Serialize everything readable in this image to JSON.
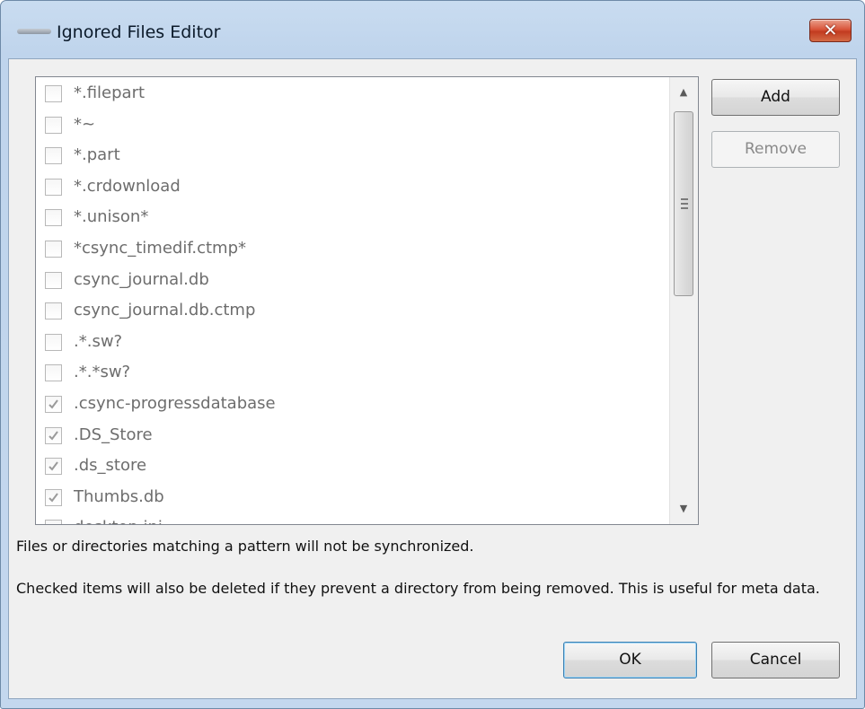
{
  "window": {
    "title": "Ignored Files Editor",
    "close_glyph": "✕",
    "title_icon": "owncloud-icon"
  },
  "list": {
    "items": [
      {
        "label": "*.filepart",
        "checked": false
      },
      {
        "label": "*~",
        "checked": false
      },
      {
        "label": "*.part",
        "checked": false
      },
      {
        "label": "*.crdownload",
        "checked": false
      },
      {
        "label": "*.unison*",
        "checked": false
      },
      {
        "label": "*csync_timedif.ctmp*",
        "checked": false
      },
      {
        "label": "csync_journal.db",
        "checked": false
      },
      {
        "label": "csync_journal.db.ctmp",
        "checked": false
      },
      {
        "label": ".*.sw?",
        "checked": false
      },
      {
        "label": ".*.*sw?",
        "checked": false
      },
      {
        "label": ".csync-progressdatabase",
        "checked": true
      },
      {
        "label": ".DS_Store",
        "checked": true
      },
      {
        "label": ".ds_store",
        "checked": true
      },
      {
        "label": "Thumbs.db",
        "checked": true
      },
      {
        "label": "desktop.ini",
        "checked": false
      }
    ],
    "scroll": {
      "up_glyph": "▲",
      "down_glyph": "▼"
    }
  },
  "buttons": {
    "add": "Add",
    "remove": "Remove",
    "ok": "OK",
    "cancel": "Cancel"
  },
  "description": {
    "line1": "Files or directories matching a pattern will not be synchronized.",
    "line2": "Checked items will also be deleted if they prevent a directory from being removed. This is useful for meta data."
  }
}
